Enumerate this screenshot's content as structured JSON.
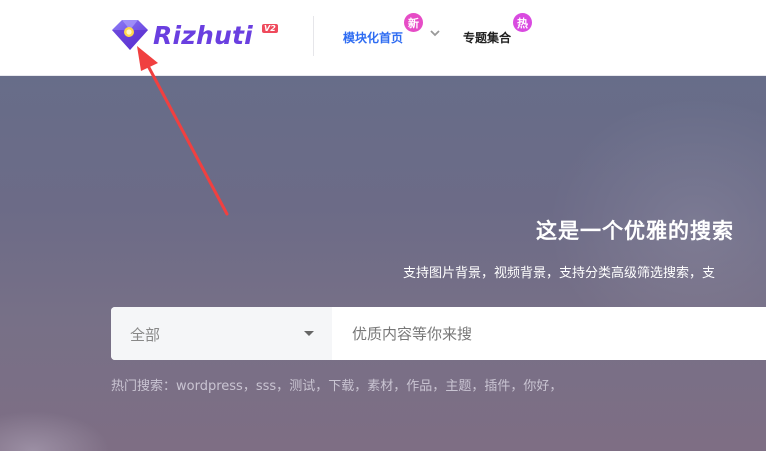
{
  "header": {
    "logo_text": "Rizhuti",
    "logo_badge": "V2",
    "nav": [
      {
        "label": "模块化首页",
        "badge": "新"
      },
      {
        "label": "专题集合",
        "badge": "热"
      }
    ]
  },
  "hero": {
    "title": "这是一个优雅的搜索",
    "subtitle": "支持图片背景，视频背景，支持分类高级筛选搜索，支"
  },
  "search": {
    "category_value": "全部",
    "placeholder": "优质内容等你来搜"
  },
  "hot_search": {
    "label": "热门搜索：",
    "keywords": [
      "wordpress",
      "sss",
      "测试",
      "下载",
      "素材",
      "作品",
      "主题",
      "插件",
      "你好"
    ]
  },
  "colors": {
    "accent": "#2e6cf2",
    "logo": "#6a3fe0",
    "annotation": "#f04040"
  }
}
